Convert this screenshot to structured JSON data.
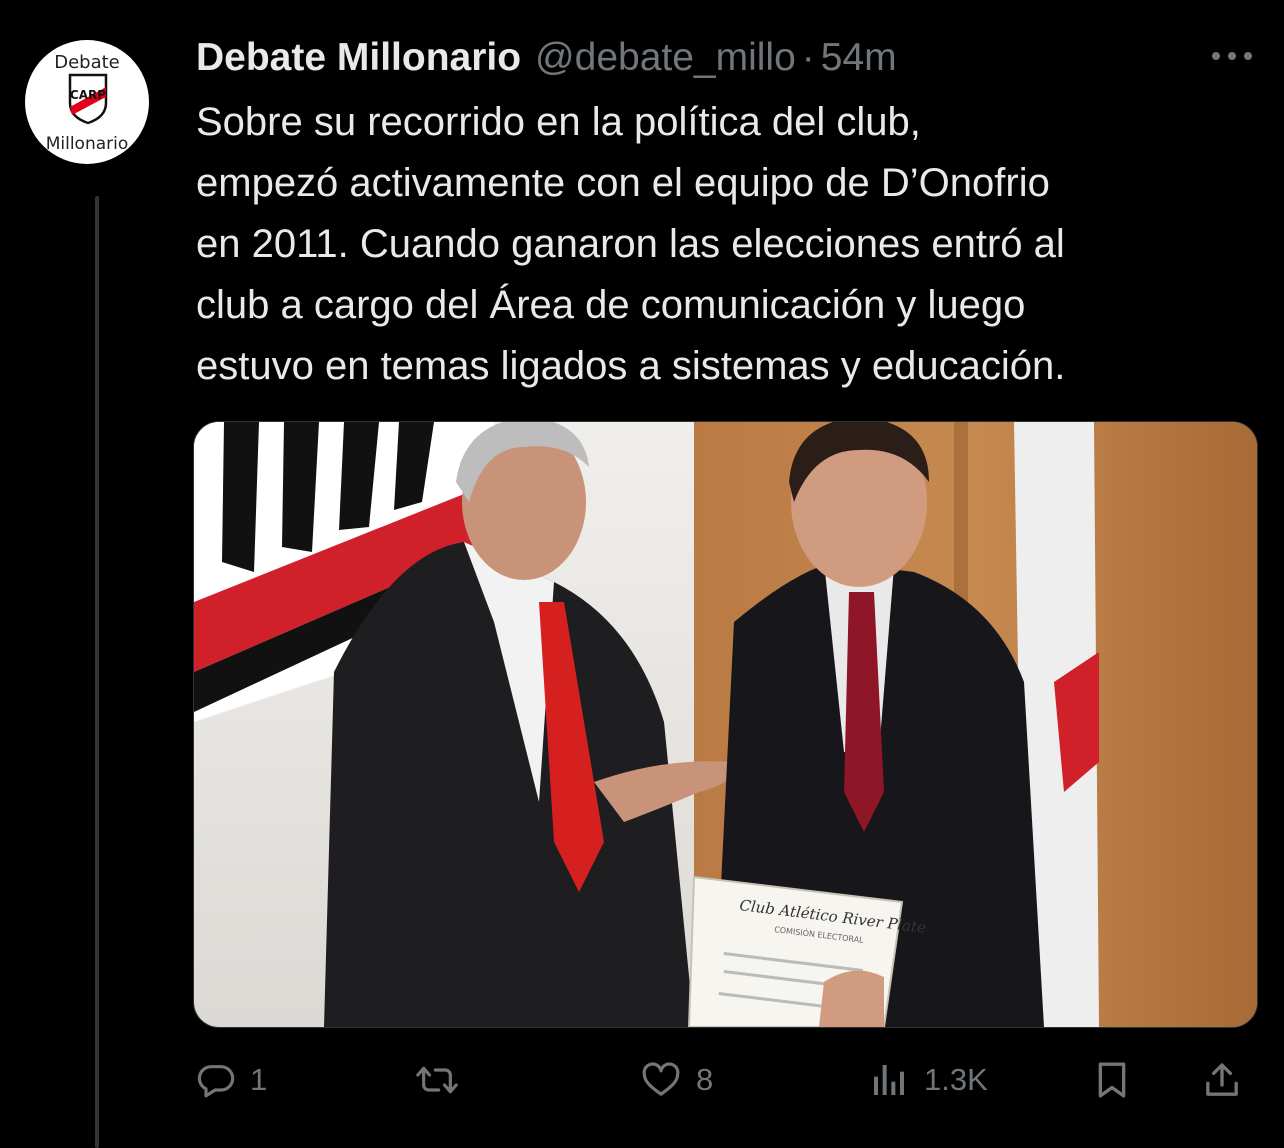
{
  "tweet": {
    "author_name": "Debate Millonario",
    "handle": "@debate_millo",
    "separator": "·",
    "time": "54m",
    "text_lines": [
      "Sobre su recorrido en la política del club,",
      "empezó activamente con el equipo de D’Onofrio",
      "en 2011. Cuando ganaron las elecciones entró al",
      "club a cargo del Área de comunicación y luego",
      "estuvo en temas ligados a sistemas y educación."
    ]
  },
  "avatar": {
    "top_text": "Debate",
    "bottom_text": "Millonario",
    "crest_text": "CARP",
    "colors": {
      "red": "#e2001a",
      "black": "#111111"
    }
  },
  "photo": {
    "certificate_title": "Club Atlético River Plate",
    "certificate_subtitle": "COMISIÓN ELECTORAL"
  },
  "actions": {
    "reply": {
      "icon": "reply-icon",
      "count": "1"
    },
    "retweet": {
      "icon": "retweet-icon",
      "count": ""
    },
    "like": {
      "icon": "heart-icon",
      "count": "8"
    },
    "views": {
      "icon": "views-icon",
      "count": "1.3K"
    },
    "bookmark": {
      "icon": "bookmark-icon"
    },
    "share": {
      "icon": "share-icon"
    }
  },
  "colors": {
    "background": "#000000",
    "primary_text": "#e7e9ea",
    "secondary_text": "#71767b",
    "thread_line": "#333639"
  }
}
